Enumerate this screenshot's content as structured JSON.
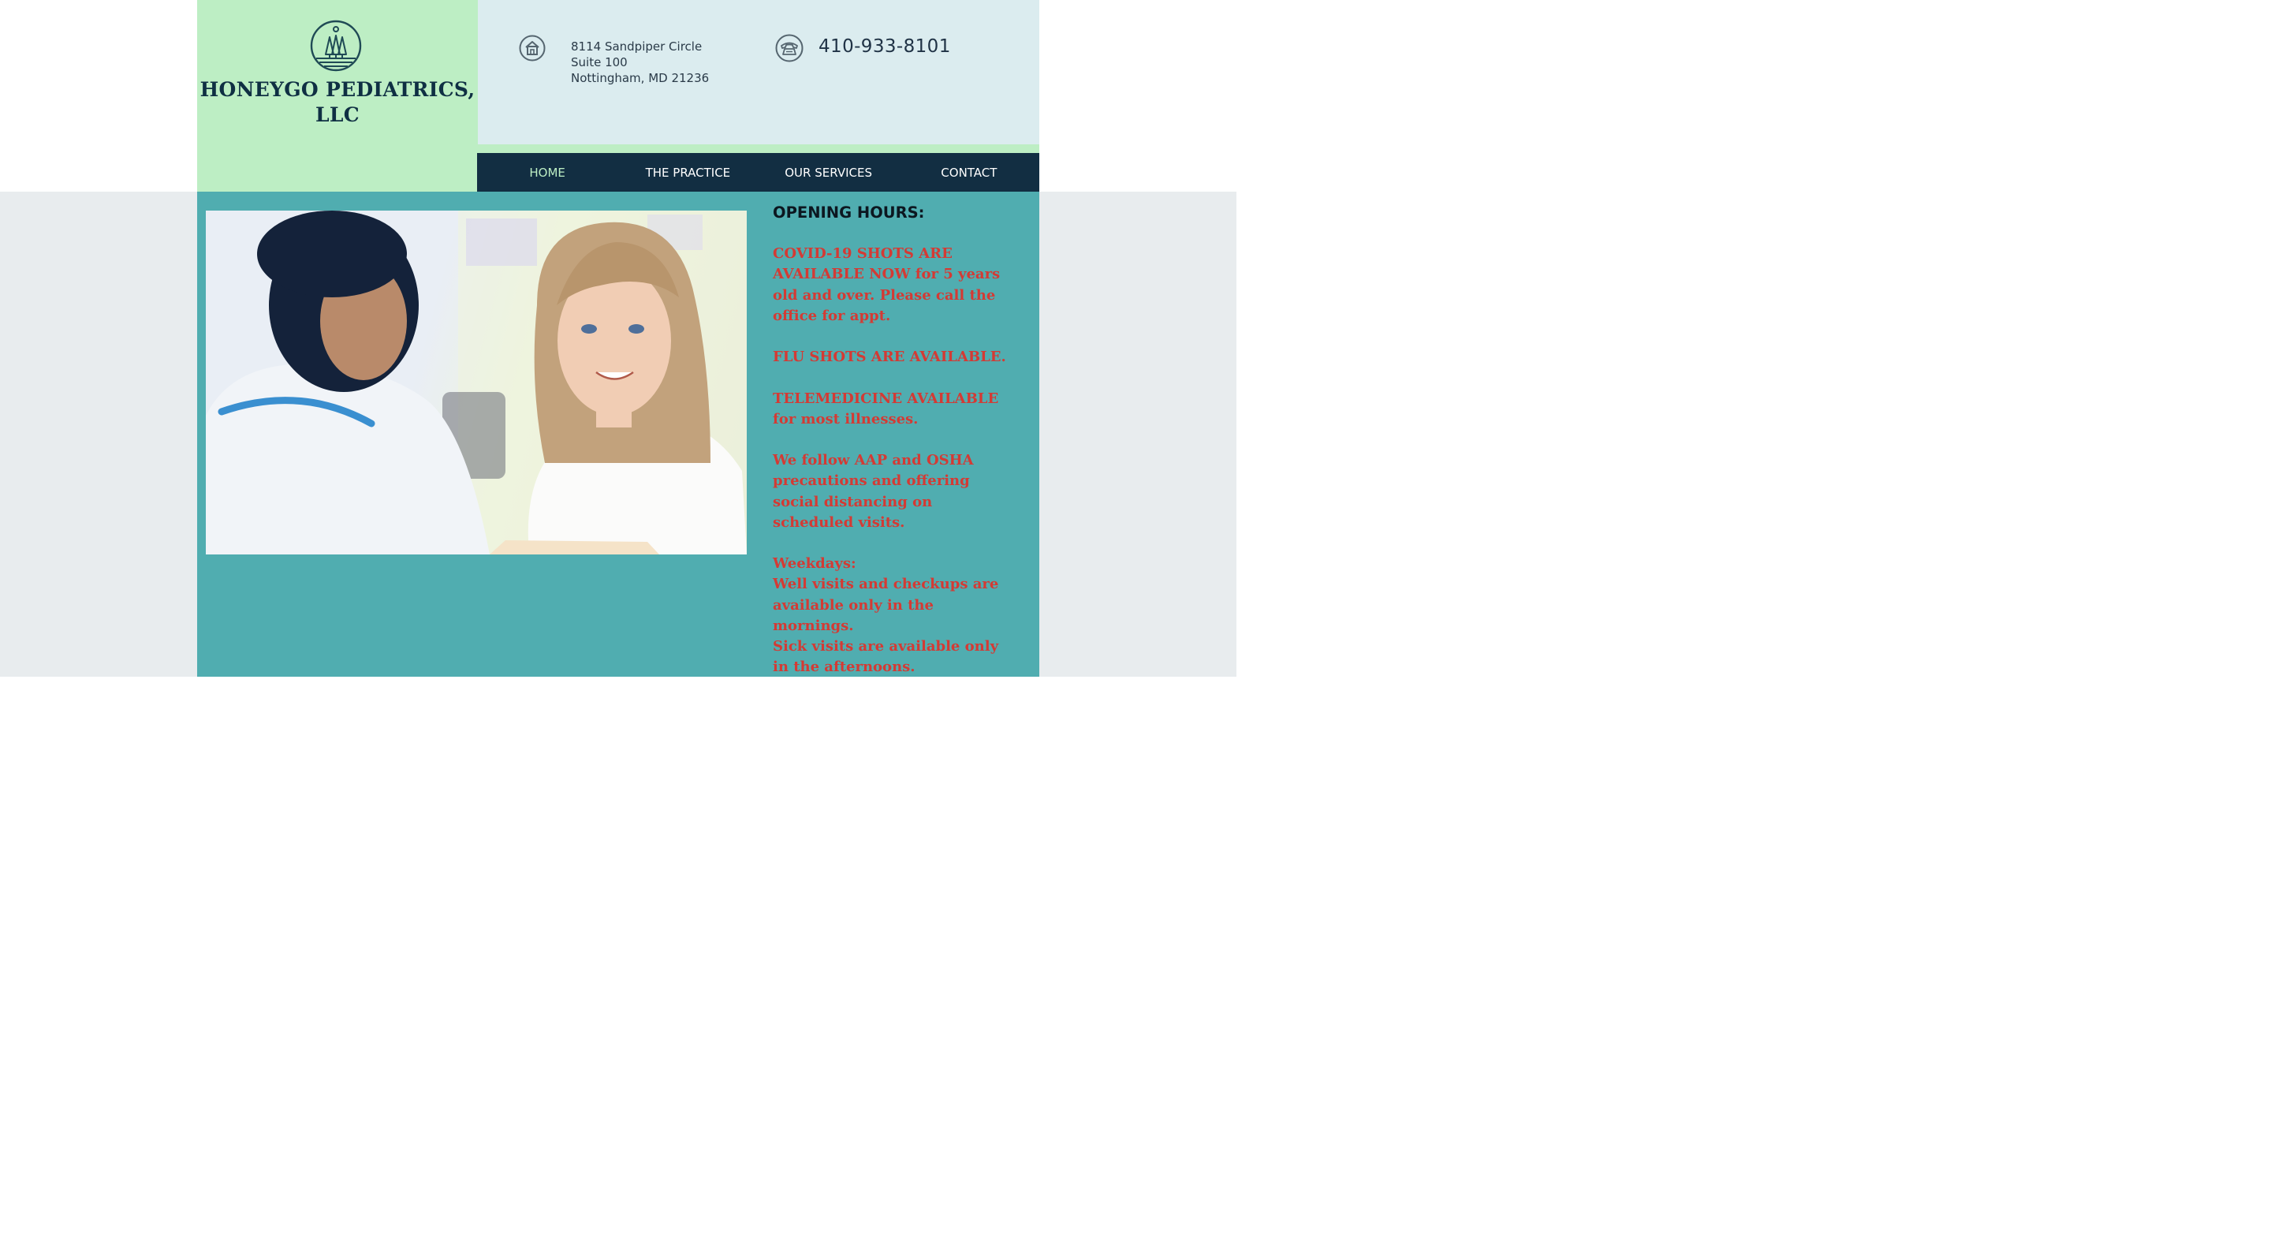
{
  "site": {
    "title_line1": "HONEYGO PEDIATRICS,",
    "title_line2": "LLC",
    "logo_icon": "three-trees-circle-icon"
  },
  "contact": {
    "address_icon": "house-icon",
    "address_line1": "8114 Sandpiper Circle",
    "address_line2": "Suite 100",
    "address_line3": "Nottingham, MD 21236",
    "phone_icon": "telephone-icon",
    "phone": "410-933-8101"
  },
  "nav": {
    "items": [
      {
        "label": "HOME",
        "active": true
      },
      {
        "label": "THE PRACTICE",
        "active": false
      },
      {
        "label": "OUR SERVICES",
        "active": false
      },
      {
        "label": "CONTACT",
        "active": false
      }
    ]
  },
  "hours": {
    "title": "OPENING HOURS:",
    "covid_1": "COVID-19 SHOTS ARE",
    "covid_2": "AVAILABLE NOW for 5 years",
    "covid_3": "old and over. Please call the",
    "covid_4": "office for appt.",
    "flu": "FLU SHOTS ARE AVAILABLE.",
    "tele_1": "TELEMEDICINE AVAILABLE",
    "tele_2": "for most illnesses.",
    "aap_1": "We follow AAP and OSHA",
    "aap_2": "precautions and offering",
    "aap_3": "social distancing on",
    "aap_4": "scheduled visits.",
    "weekdays": "Weekdays:",
    "well_1": "Well visits and checkups are",
    "well_2": "available only in the",
    "well_3": "mornings.",
    "sick_1": "Sick visits are available only",
    "sick_2": "in the afternoons."
  },
  "colors": {
    "logo_panel": "#bdeec4",
    "info_panel": "#dbecef",
    "navbar": "#122e42",
    "content": "#50adb0",
    "accent_red": "#d43a34",
    "title_navy": "#0f2f43"
  }
}
